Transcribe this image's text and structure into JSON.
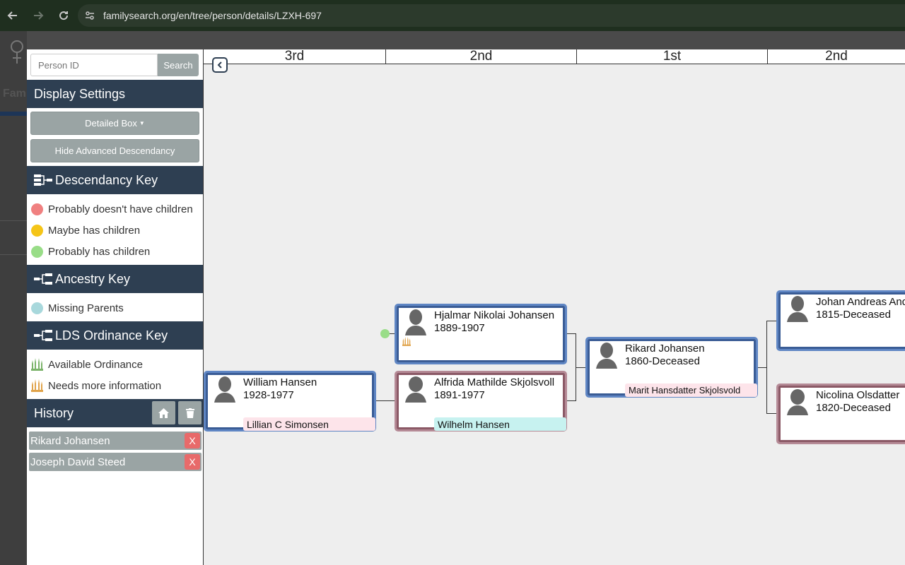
{
  "browser": {
    "url": "familysearch.org/en/tree/person/details/LZXH-697"
  },
  "background": {
    "fam_label": "Fam"
  },
  "sidebar": {
    "search_placeholder": "Person ID",
    "search_label": "Search",
    "display_settings": {
      "title": "Display Settings",
      "box_style_label": "Detailed Box",
      "advanced_label": "Hide Advanced Descendancy"
    },
    "descendancy_key": {
      "title": "Descendancy Key",
      "items": [
        {
          "label": "Probably doesn't have children",
          "color": "#f08080"
        },
        {
          "label": "Maybe has children",
          "color": "#f5c518"
        },
        {
          "label": "Probably has children",
          "color": "#99dd88"
        }
      ]
    },
    "ancestry_key": {
      "title": "Ancestry Key",
      "items": [
        {
          "label": "Missing Parents",
          "color": "#a8d8dc"
        }
      ]
    },
    "lds_key": {
      "title": "LDS Ordinance Key",
      "items": [
        {
          "label": "Available Ordinance",
          "icon": "temple-green-icon",
          "color": "#7bb36a"
        },
        {
          "label": "Needs more information",
          "icon": "temple-orange-icon",
          "color": "#e0a34a"
        }
      ]
    },
    "history": {
      "title": "History",
      "items": [
        {
          "label": "Rikard Johansen",
          "remove": "X"
        },
        {
          "label": "Joseph David Steed",
          "remove": "X"
        }
      ]
    }
  },
  "chart": {
    "generations": [
      "3rd",
      "2nd",
      "1st",
      "2nd"
    ],
    "people": {
      "william": {
        "name": "William Hansen",
        "dates": "1928-1977",
        "spouse": "Lillian C Simonsen"
      },
      "hjalmar": {
        "name": "Hjalmar Nikolai Johansen",
        "dates": "1889-1907"
      },
      "alfrida": {
        "name": "Alfrida Mathilde Skjolsvoll",
        "dates": "1891-1977",
        "spouse": "Wilhelm Hansen"
      },
      "rikard": {
        "name": "Rikard Johansen",
        "dates": "1860-Deceased",
        "spouse": "Marit Hansdatter Skjolsvold"
      },
      "johan": {
        "name": "Johan Andreas And",
        "dates": "1815-Deceased"
      },
      "nicolina": {
        "name": "Nicolina Olsdatter",
        "dates": "1820-Deceased"
      }
    }
  }
}
